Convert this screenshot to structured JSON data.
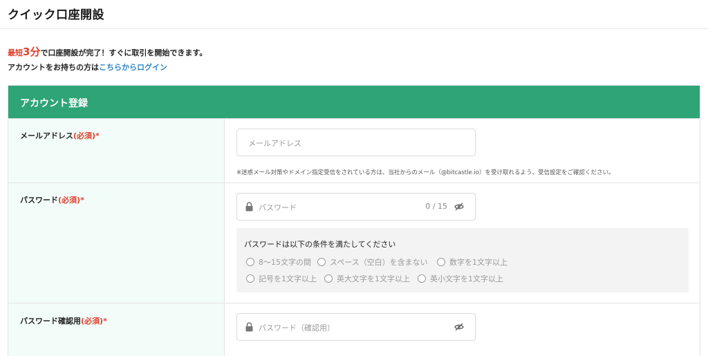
{
  "page": {
    "title": "クイック口座開設"
  },
  "intro": {
    "prefix": "最短",
    "highlight": "3分",
    "suffix": "で口座開設が完了！すぐに取引を開始できます。",
    "login_prompt": "アカウントをお持ちの方は",
    "login_link": "こちらからログイン"
  },
  "form": {
    "section_title": "アカウント登録",
    "required_tag": "(必須)",
    "asterisk": "*",
    "email": {
      "label": "メールアドレス",
      "placeholder": "メールアドレス",
      "note": "※迷惑メール対策やドメイン指定受信をされている方は、当社からのメール（@bitcastle.io）を受け取れるよう、受信設定をご確認ください。"
    },
    "password": {
      "label": "パスワード",
      "placeholder": "パスワード",
      "counter": "0 / 15",
      "conditions_title": "パスワードは以下の条件を満たしてください",
      "conditions": [
        "8〜15文字の間",
        "スペース（空白）を含まない",
        "数字を1文字以上",
        "記号を1文字以上",
        "英大文字を1文字以上",
        "英小文字を1文字以上"
      ]
    },
    "password_confirm": {
      "label": "パスワード確認用",
      "placeholder": "パスワード（確認用）"
    }
  },
  "colors": {
    "accent": "#2ea477",
    "label_bg": "#f2fcf8",
    "required": "#e0412f",
    "link": "#2f86c8"
  },
  "icons": [
    "lock-icon",
    "eye-slash-icon",
    "radio-circle-icon"
  ]
}
